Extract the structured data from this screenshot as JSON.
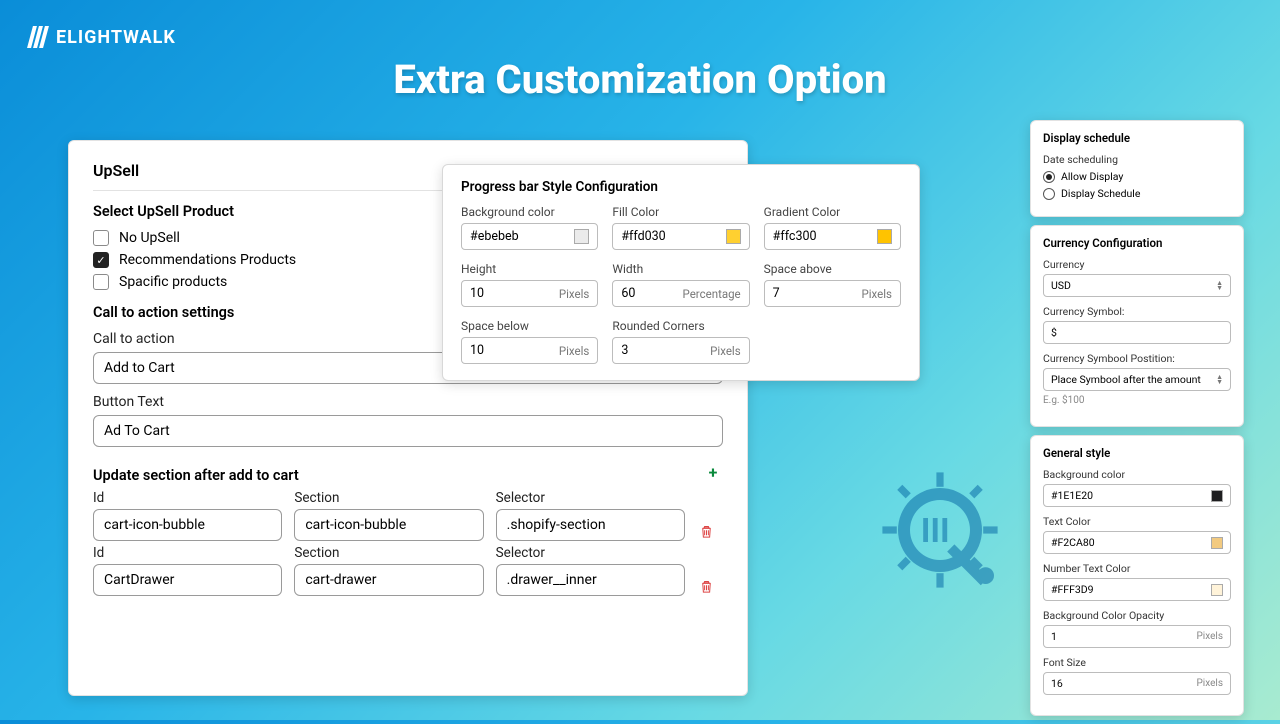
{
  "brand": "ELIGHTWALK",
  "hero": "Extra Customization Option",
  "upsell": {
    "title": "UpSell",
    "select_title": "Select UpSell Product",
    "options": [
      {
        "label": "No UpSell",
        "checked": false
      },
      {
        "label": "Recommendations Products",
        "checked": true
      },
      {
        "label": "Spacific products",
        "checked": false
      }
    ],
    "cta_settings": "Call to action settings",
    "cta_label": "Call to action",
    "cta_value": "Add to Cart",
    "btn_label": "Button Text",
    "btn_value": "Ad To Cart",
    "update_title": "Update section after add to cart",
    "cols": {
      "id": "Id",
      "section": "Section",
      "selector": "Selector"
    },
    "rows": [
      {
        "id": "cart-icon-bubble",
        "section": "cart-icon-bubble",
        "selector": ".shopify-section"
      },
      {
        "id": "CartDrawer",
        "section": "cart-drawer",
        "selector": ".drawer__inner"
      }
    ]
  },
  "progress": {
    "title": "Progress bar Style Configuration",
    "bg": {
      "label": "Background color",
      "value": "#ebebeb",
      "color": "#ebebeb"
    },
    "fill": {
      "label": "Fill Color",
      "value": "#ffd030",
      "color": "#ffd030"
    },
    "grad": {
      "label": "Gradient Color",
      "value": "#ffc300",
      "color": "#ffc300"
    },
    "height": {
      "label": "Height",
      "value": "10",
      "unit": "Pixels"
    },
    "width": {
      "label": "Width",
      "value": "60",
      "unit": "Percentage"
    },
    "space_above": {
      "label": "Space above",
      "value": "7",
      "unit": "Pixels"
    },
    "space_below": {
      "label": "Space below",
      "value": "10",
      "unit": "Pixels"
    },
    "corners": {
      "label": "Rounded Corners",
      "value": "3",
      "unit": "Pixels"
    }
  },
  "schedule": {
    "title": "Display schedule",
    "date_label": "Date scheduling",
    "allow": "Allow Display",
    "sched": "Display Schedule"
  },
  "currency": {
    "title": "Currency Configuration",
    "cur_label": "Currency",
    "cur_value": "USD",
    "sym_label": "Currency Symbol:",
    "sym_value": "$",
    "pos_label": "Currency Symbool Postition:",
    "pos_value": "Place Symbool after the amount",
    "hint": "E.g. $100"
  },
  "style": {
    "title": "General style",
    "bg": {
      "label": "Background color",
      "value": "#1E1E20",
      "color": "#1E1E20"
    },
    "text": {
      "label": "Text Color",
      "value": "#F2CA80",
      "color": "#F2CA80"
    },
    "num": {
      "label": "Number Text Color",
      "value": "#FFF3D9",
      "color": "#FFF3D9"
    },
    "opacity": {
      "label": "Background Color Opacity",
      "value": "1",
      "unit": "Pixels"
    },
    "font": {
      "label": "Font Size",
      "value": "16",
      "unit": "Pixels"
    }
  }
}
